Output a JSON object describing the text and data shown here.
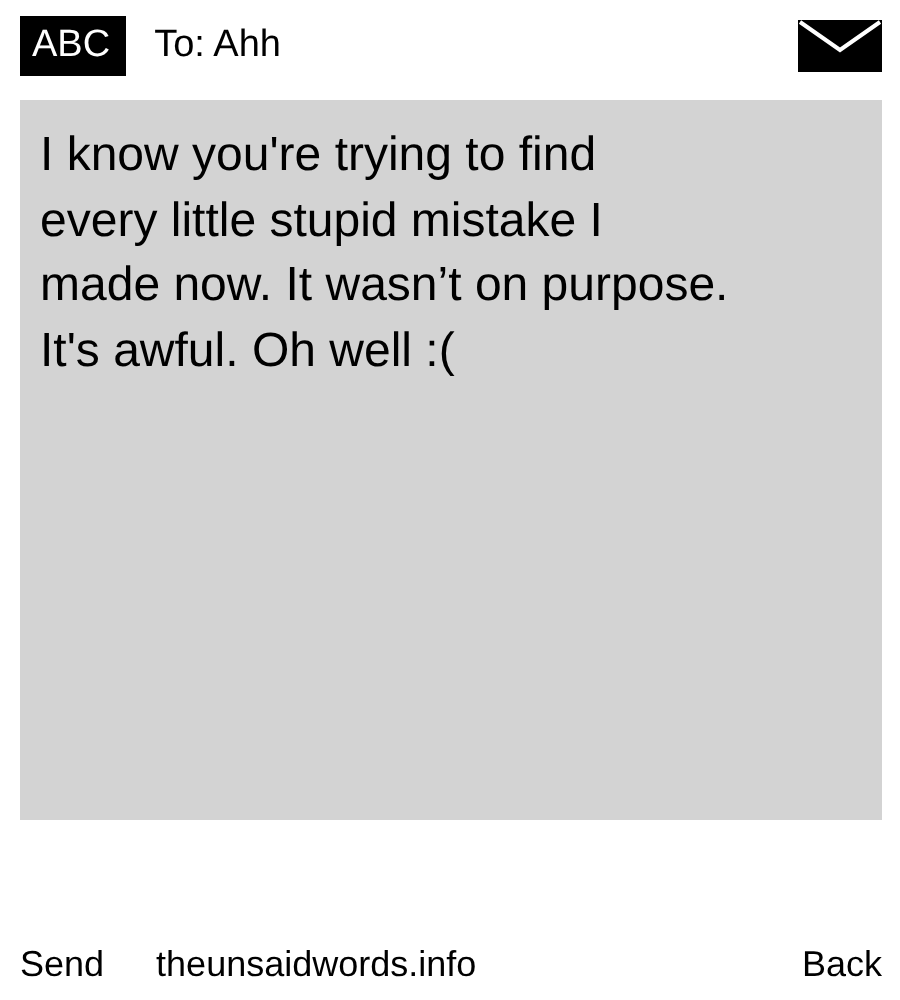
{
  "header": {
    "mode": "ABC",
    "recipient": "To: Ahh"
  },
  "message": {
    "lines": [
      "I know you're trying to find",
      "every little stupid mistake I",
      "made now. It wasn’t on purpose.",
      "It's awful. Oh well :("
    ]
  },
  "footer": {
    "left": "Send",
    "middle": "theunsaidwords.info",
    "right": "Back"
  }
}
